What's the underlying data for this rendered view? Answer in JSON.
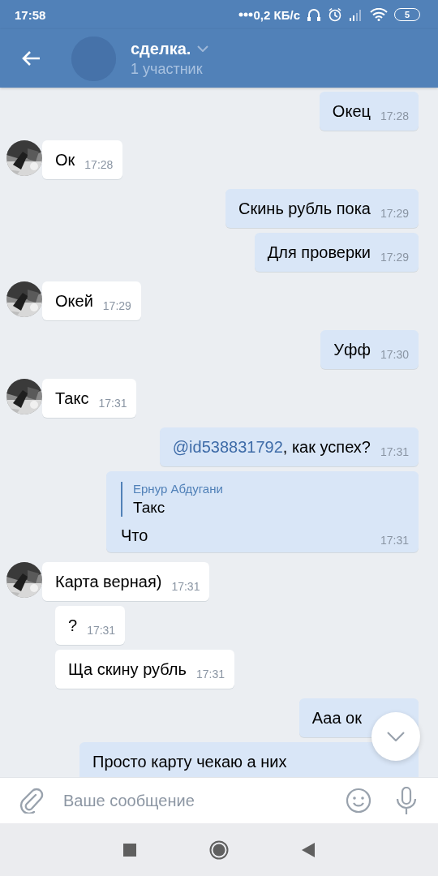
{
  "status_bar": {
    "time": "17:58",
    "net_speed": "0,2 КБ/с",
    "battery": "5"
  },
  "header": {
    "title": "сделка.",
    "subtitle": "1 участник"
  },
  "messages": [
    {
      "kind": "outgoing",
      "text": "Окец",
      "time": "17:28"
    },
    {
      "kind": "incoming",
      "text": "Ок",
      "time": "17:28"
    },
    {
      "kind": "outgoing",
      "text": "Скинь рубль пока",
      "time": "17:29"
    },
    {
      "kind": "outgoing",
      "text": "Для проверки",
      "time": "17:29"
    },
    {
      "kind": "incoming",
      "text": "Окей",
      "time": "17:29"
    },
    {
      "kind": "outgoing",
      "text": "Уфф",
      "time": "17:30"
    },
    {
      "kind": "incoming",
      "text": "Такс",
      "time": "17:31"
    },
    {
      "kind": "outgoing",
      "mention": "@id538831792",
      "text": ", как успех?",
      "time": "17:31"
    },
    {
      "kind": "outgoing",
      "reply": {
        "author": "Ернур Абдугани",
        "text": "Такс"
      },
      "text": "Что",
      "time": "17:31"
    },
    {
      "kind": "incoming",
      "text": "Карта верная)",
      "time": "17:31"
    },
    {
      "kind": "incoming",
      "text": "?",
      "time": "17:31"
    },
    {
      "kind": "incoming",
      "text": "Ща скину рубль",
      "time": "17:31"
    },
    {
      "kind": "outgoing",
      "text": "Ааа ок"
    },
    {
      "kind": "outgoing",
      "text": "Просто карту чекаю а них"
    }
  ],
  "composer": {
    "placeholder": "Ваше сообщение"
  }
}
